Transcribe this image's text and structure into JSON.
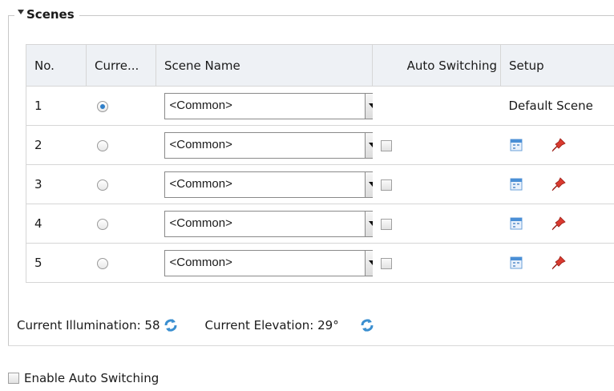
{
  "group": {
    "title": "Scenes"
  },
  "table": {
    "headers": [
      "No.",
      "Curre...",
      "Scene Name",
      "Auto Switching",
      "Setup"
    ],
    "rows": [
      {
        "no": "1",
        "current": true,
        "scene": "<Common>",
        "setup_text": "Default Scene"
      },
      {
        "no": "2",
        "current": false,
        "scene": "<Common>"
      },
      {
        "no": "3",
        "current": false,
        "scene": "<Common>"
      },
      {
        "no": "4",
        "current": false,
        "scene": "<Common>"
      },
      {
        "no": "5",
        "current": false,
        "scene": "<Common>"
      }
    ]
  },
  "status": {
    "illumination": "Current Illumination: 58",
    "elevation": "Current Elevation: 29°"
  },
  "enable_auto_switching": "Enable Auto Switching",
  "icons": {
    "refresh": "refresh-icon",
    "schedule": "calendar-icon",
    "pin": "pin-icon"
  }
}
